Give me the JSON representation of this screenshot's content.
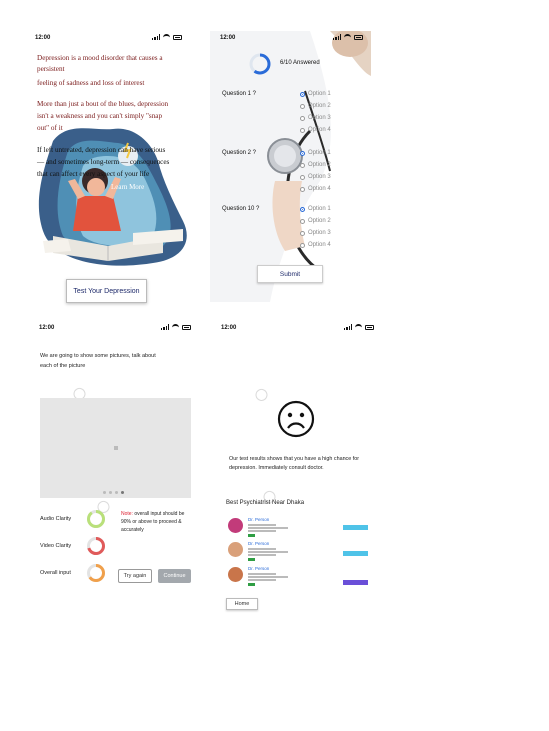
{
  "statusbar": {
    "time": "12:00"
  },
  "screen1": {
    "lines": [
      "Depression is a mood disorder that causes a",
      "persistent",
      "feeling of sadness and loss of interest",
      "More than just a bout of the blues, depression",
      "isn't a weakness and you can't simply \"snap",
      "out\" of it",
      "If left untreated, depression can have serious",
      "— and sometimes long-term — consequences",
      "that can affect every aspect of your life"
    ],
    "learn_more": "Learn More",
    "cta": "Test Your Depression"
  },
  "screen2": {
    "answered": "6/10 Answered",
    "questions": [
      {
        "label": "Question 1 ?",
        "options": [
          "Option 1",
          "Option 2",
          "Option 3",
          "Option 4"
        ],
        "selected": 0
      },
      {
        "label": "Question 2 ?",
        "options": [
          "Option 1",
          "Option 2",
          "Option 3",
          "Option 4"
        ],
        "selected": 0
      },
      {
        "label": "Question 10 ?",
        "options": [
          "Option 1",
          "Option 2",
          "Option 3",
          "Option 4"
        ],
        "selected": 0
      }
    ],
    "progress_fraction": 0.6,
    "submit": "Submit"
  },
  "screen3": {
    "intro_line1": "We are going to show some pictures, talk about",
    "intro_line2": "each of the picture",
    "metrics": [
      {
        "label": "Audio Clarity",
        "value": 0.9,
        "color": "#b9e07a"
      },
      {
        "label": "Video Clarity",
        "value": 0.7,
        "color": "#e05a5a"
      },
      {
        "label": "Overall input",
        "value": 0.65,
        "color": "#f0a04b"
      }
    ],
    "note_prefix": "Note:",
    "note_text": " overall input should be 90% or above to proceed & accurately",
    "try_again": "Try again",
    "continue": "Continue"
  },
  "screen4": {
    "result_line1": "Our test results shows that you have a high chance for",
    "result_line2": "depression. Immediately consult doctor.",
    "section_title": "Best Psychiatrist Near Dhaka",
    "doctors": [
      {
        "name": "Dr. Person",
        "avatar_color": "#c23b7a",
        "button_color": "#4fc3e8"
      },
      {
        "name": "Dr. Person",
        "avatar_color": "#d9a07a",
        "button_color": "#4fc3e8"
      },
      {
        "name": "Dr. Person",
        "avatar_color": "#c9754a",
        "button_color": "#6a4fd8"
      }
    ],
    "home": "Home"
  }
}
